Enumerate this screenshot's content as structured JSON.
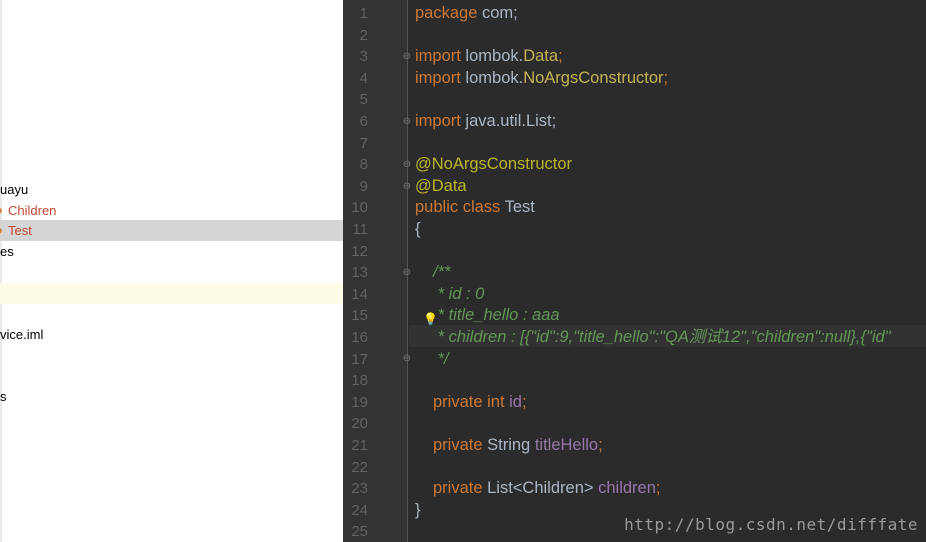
{
  "project_tree": {
    "items": [
      {
        "label": "uayu"
      },
      {
        "label": "Children"
      },
      {
        "label": "Test"
      },
      {
        "label": "es"
      },
      {
        "label": "vice.iml"
      },
      {
        "label": "s"
      }
    ]
  },
  "editor": {
    "line_numbers": [
      "1",
      "2",
      "3",
      "4",
      "5",
      "6",
      "7",
      "8",
      "9",
      "10",
      "11",
      "12",
      "13",
      "14",
      "15",
      "16",
      "17",
      "18",
      "19",
      "20",
      "21",
      "22",
      "23",
      "24",
      "25"
    ],
    "code": {
      "l1_kw": "package",
      "l1_rest": " com;",
      "l3_kw": "import",
      "l3_pkg": " lombok.",
      "l3_cls": "Data",
      "l3_end": ";",
      "l4_kw": "import",
      "l4_pkg": " lombok.",
      "l4_cls": "NoArgsConstructor",
      "l4_end": ";",
      "l6_kw": "import",
      "l6_rest": " java.util.List;",
      "l8_ann": "@NoArgsConstructor",
      "l9_ann": "@Data",
      "l10_kw": "public class",
      "l10_rest": " Test",
      "l11": "{",
      "l13": "/**",
      "l14": " * id : 0",
      "l15": " * title_hello : aaa",
      "l16": " * children : [{\"id\":9,\"title_hello\":\"QA测试12\",\"children\":null},{\"id\"",
      "l17": " */",
      "l19_kw": "private int",
      "l19_fld": " id",
      "l19_end": ";",
      "l21_kw": "private",
      "l21_type": " String ",
      "l21_fld": "titleHello",
      "l21_end": ";",
      "l23_kw": "private",
      "l23_type": " List<Children> ",
      "l23_fld": "children",
      "l23_end": ";",
      "l24": "}"
    }
  },
  "watermark": "http://blog.csdn.net/difffate"
}
